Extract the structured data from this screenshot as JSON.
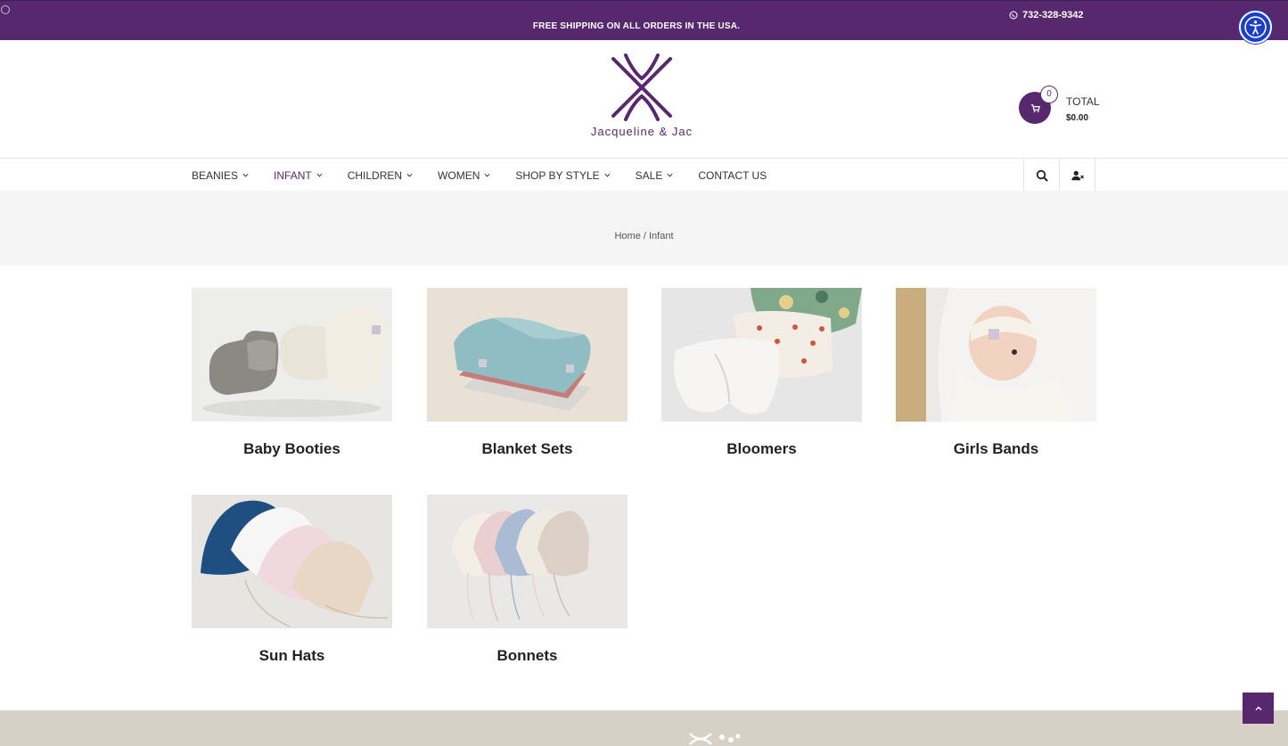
{
  "topbar": {
    "phone": "732-328-9342",
    "shipping": "FREE SHIPPING ON ALL ORDERS IN THE USA."
  },
  "brand": {
    "name": "Jacqueline & Jac",
    "color": "#58286e"
  },
  "cart": {
    "count": "0",
    "total_label": "TOTAL",
    "total_value": "$0.00"
  },
  "nav": {
    "items": [
      {
        "label": "BEANIES",
        "dropdown": true
      },
      {
        "label": "INFANT",
        "dropdown": true,
        "active": true
      },
      {
        "label": "CHILDREN",
        "dropdown": true
      },
      {
        "label": "WOMEN",
        "dropdown": true
      },
      {
        "label": "SHOP BY STYLE",
        "dropdown": true
      },
      {
        "label": "SALE",
        "dropdown": true
      },
      {
        "label": "CONTACT US",
        "dropdown": false
      }
    ],
    "icons": [
      "search-icon",
      "user-icon"
    ]
  },
  "breadcrumb": "Home / Infant",
  "categories": [
    {
      "title": "Baby Booties"
    },
    {
      "title": "Blanket Sets"
    },
    {
      "title": "Bloomers"
    },
    {
      "title": "Girls Bands"
    },
    {
      "title": "Sun Hats"
    },
    {
      "title": "Bonnets"
    }
  ],
  "colors": {
    "accent": "#58286e",
    "accessibility": "#1a3ec9",
    "footer": "#d6d0c6"
  }
}
